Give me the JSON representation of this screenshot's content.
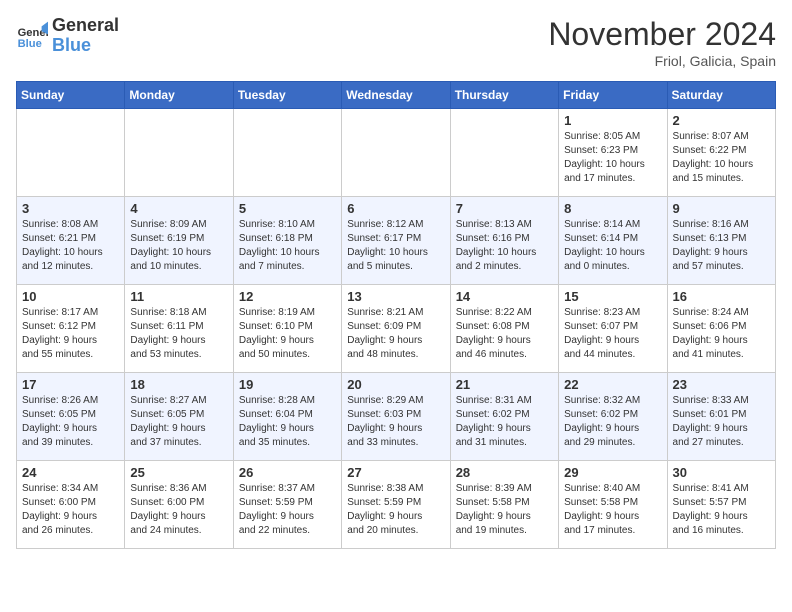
{
  "logo": {
    "line1": "General",
    "line2": "Blue"
  },
  "title": "November 2024",
  "location": "Friol, Galicia, Spain",
  "weekdays": [
    "Sunday",
    "Monday",
    "Tuesday",
    "Wednesday",
    "Thursday",
    "Friday",
    "Saturday"
  ],
  "weeks": [
    [
      {
        "day": "",
        "info": ""
      },
      {
        "day": "",
        "info": ""
      },
      {
        "day": "",
        "info": ""
      },
      {
        "day": "",
        "info": ""
      },
      {
        "day": "",
        "info": ""
      },
      {
        "day": "1",
        "info": "Sunrise: 8:05 AM\nSunset: 6:23 PM\nDaylight: 10 hours\nand 17 minutes."
      },
      {
        "day": "2",
        "info": "Sunrise: 8:07 AM\nSunset: 6:22 PM\nDaylight: 10 hours\nand 15 minutes."
      }
    ],
    [
      {
        "day": "3",
        "info": "Sunrise: 8:08 AM\nSunset: 6:21 PM\nDaylight: 10 hours\nand 12 minutes."
      },
      {
        "day": "4",
        "info": "Sunrise: 8:09 AM\nSunset: 6:19 PM\nDaylight: 10 hours\nand 10 minutes."
      },
      {
        "day": "5",
        "info": "Sunrise: 8:10 AM\nSunset: 6:18 PM\nDaylight: 10 hours\nand 7 minutes."
      },
      {
        "day": "6",
        "info": "Sunrise: 8:12 AM\nSunset: 6:17 PM\nDaylight: 10 hours\nand 5 minutes."
      },
      {
        "day": "7",
        "info": "Sunrise: 8:13 AM\nSunset: 6:16 PM\nDaylight: 10 hours\nand 2 minutes."
      },
      {
        "day": "8",
        "info": "Sunrise: 8:14 AM\nSunset: 6:14 PM\nDaylight: 10 hours\nand 0 minutes."
      },
      {
        "day": "9",
        "info": "Sunrise: 8:16 AM\nSunset: 6:13 PM\nDaylight: 9 hours\nand 57 minutes."
      }
    ],
    [
      {
        "day": "10",
        "info": "Sunrise: 8:17 AM\nSunset: 6:12 PM\nDaylight: 9 hours\nand 55 minutes."
      },
      {
        "day": "11",
        "info": "Sunrise: 8:18 AM\nSunset: 6:11 PM\nDaylight: 9 hours\nand 53 minutes."
      },
      {
        "day": "12",
        "info": "Sunrise: 8:19 AM\nSunset: 6:10 PM\nDaylight: 9 hours\nand 50 minutes."
      },
      {
        "day": "13",
        "info": "Sunrise: 8:21 AM\nSunset: 6:09 PM\nDaylight: 9 hours\nand 48 minutes."
      },
      {
        "day": "14",
        "info": "Sunrise: 8:22 AM\nSunset: 6:08 PM\nDaylight: 9 hours\nand 46 minutes."
      },
      {
        "day": "15",
        "info": "Sunrise: 8:23 AM\nSunset: 6:07 PM\nDaylight: 9 hours\nand 44 minutes."
      },
      {
        "day": "16",
        "info": "Sunrise: 8:24 AM\nSunset: 6:06 PM\nDaylight: 9 hours\nand 41 minutes."
      }
    ],
    [
      {
        "day": "17",
        "info": "Sunrise: 8:26 AM\nSunset: 6:05 PM\nDaylight: 9 hours\nand 39 minutes."
      },
      {
        "day": "18",
        "info": "Sunrise: 8:27 AM\nSunset: 6:05 PM\nDaylight: 9 hours\nand 37 minutes."
      },
      {
        "day": "19",
        "info": "Sunrise: 8:28 AM\nSunset: 6:04 PM\nDaylight: 9 hours\nand 35 minutes."
      },
      {
        "day": "20",
        "info": "Sunrise: 8:29 AM\nSunset: 6:03 PM\nDaylight: 9 hours\nand 33 minutes."
      },
      {
        "day": "21",
        "info": "Sunrise: 8:31 AM\nSunset: 6:02 PM\nDaylight: 9 hours\nand 31 minutes."
      },
      {
        "day": "22",
        "info": "Sunrise: 8:32 AM\nSunset: 6:02 PM\nDaylight: 9 hours\nand 29 minutes."
      },
      {
        "day": "23",
        "info": "Sunrise: 8:33 AM\nSunset: 6:01 PM\nDaylight: 9 hours\nand 27 minutes."
      }
    ],
    [
      {
        "day": "24",
        "info": "Sunrise: 8:34 AM\nSunset: 6:00 PM\nDaylight: 9 hours\nand 26 minutes."
      },
      {
        "day": "25",
        "info": "Sunrise: 8:36 AM\nSunset: 6:00 PM\nDaylight: 9 hours\nand 24 minutes."
      },
      {
        "day": "26",
        "info": "Sunrise: 8:37 AM\nSunset: 5:59 PM\nDaylight: 9 hours\nand 22 minutes."
      },
      {
        "day": "27",
        "info": "Sunrise: 8:38 AM\nSunset: 5:59 PM\nDaylight: 9 hours\nand 20 minutes."
      },
      {
        "day": "28",
        "info": "Sunrise: 8:39 AM\nSunset: 5:58 PM\nDaylight: 9 hours\nand 19 minutes."
      },
      {
        "day": "29",
        "info": "Sunrise: 8:40 AM\nSunset: 5:58 PM\nDaylight: 9 hours\nand 17 minutes."
      },
      {
        "day": "30",
        "info": "Sunrise: 8:41 AM\nSunset: 5:57 PM\nDaylight: 9 hours\nand 16 minutes."
      }
    ]
  ]
}
